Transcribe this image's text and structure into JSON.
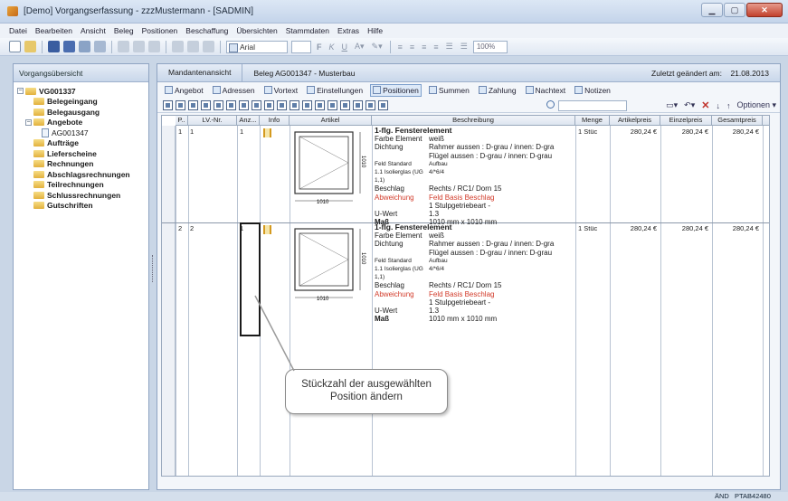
{
  "window": {
    "title": "[Demo] Vorgangserfassung - zzzMustermann - [SADMIN]"
  },
  "menu": [
    "Datei",
    "Bearbeiten",
    "Ansicht",
    "Beleg",
    "Positionen",
    "Beschaffung",
    "Übersichten",
    "Stammdaten",
    "Extras",
    "Hilfe"
  ],
  "toolbar": {
    "font": "Arial",
    "zoom": "100%"
  },
  "sidebar": {
    "header": "Vorgangsübersicht",
    "tree": [
      {
        "label": "VG001337",
        "level": 0,
        "bold": true,
        "expander": "−",
        "icon": "folder"
      },
      {
        "label": "Belegeingang",
        "level": 1,
        "bold": true,
        "icon": "folder"
      },
      {
        "label": "Belegausgang",
        "level": 1,
        "bold": true,
        "icon": "folder"
      },
      {
        "label": "Angebote",
        "level": 1,
        "bold": true,
        "expander": "−",
        "icon": "folder"
      },
      {
        "label": "AG001347",
        "level": 2,
        "bold": false,
        "icon": "doc"
      },
      {
        "label": "Aufträge",
        "level": 1,
        "bold": true,
        "icon": "folder"
      },
      {
        "label": "Lieferscheine",
        "level": 1,
        "bold": true,
        "icon": "folder"
      },
      {
        "label": "Rechnungen",
        "level": 1,
        "bold": true,
        "icon": "folder"
      },
      {
        "label": "Abschlagsrechnungen",
        "level": 1,
        "bold": true,
        "icon": "folder"
      },
      {
        "label": "Teilrechnungen",
        "level": 1,
        "bold": true,
        "icon": "folder"
      },
      {
        "label": "Schlussrechnungen",
        "level": 1,
        "bold": true,
        "icon": "folder"
      },
      {
        "label": "Gutschriften",
        "level": 1,
        "bold": true,
        "icon": "folder"
      }
    ]
  },
  "header": {
    "tab": "Mandantenansicht",
    "beleg": "Beleg AG001347 - Musterbau",
    "changed_label": "Zuletzt geändert am:",
    "changed_date": "21.08.2013"
  },
  "actions": [
    {
      "label": "Angebot",
      "selected": false
    },
    {
      "label": "Adressen",
      "selected": false
    },
    {
      "label": "Vortext",
      "selected": false
    },
    {
      "label": "Einstellungen",
      "selected": false
    },
    {
      "label": "Positionen",
      "selected": true
    },
    {
      "label": "Summen",
      "selected": false
    },
    {
      "label": "Zahlung",
      "selected": false
    },
    {
      "label": "Nachtext",
      "selected": false
    },
    {
      "label": "Notizen",
      "selected": false
    }
  ],
  "options_label": "Optionen",
  "grid": {
    "columns": [
      "P..",
      "LV.-Nr.",
      "Anz...",
      "Info",
      "Artikel",
      "Beschreibung",
      "Menge",
      "Artikelpreis",
      "Einzelpreis",
      "Gesamtpreis"
    ],
    "rows": [
      {
        "p": "1",
        "lv": "1",
        "anz": "1",
        "dim_w": "1010",
        "dim_h": "1010",
        "menge": "1 Stüc",
        "artikelpreis": "280,24 €",
        "einzelpreis": "280,24 €",
        "gesamtpreis": "280,24 €",
        "title": "1-flg. Fensterelement",
        "farbe_k": "Farbe Element",
        "farbe_v": "weiß",
        "dicht_k": "Dichtung",
        "dicht_v1": "Rahmer aussen : D-grau / innen: D-gra",
        "dicht_v2": "Flügel aussen : D-grau / innen: D-grau",
        "feld_k": "Feld  Standard",
        "feld_v": "Aufbau",
        "glas_k": "1.1   Isolierglas (UG 1,1)",
        "glas_v": "4/*6/4",
        "beschlag_k": "Beschlag",
        "beschlag_v": "Rechts / RC1/ Dorn 15",
        "abw_k": "Abweichung",
        "abw_v": "Feld   Basis Beschlag",
        "stulp_v": "1   Stulpgetriebeart   -",
        "uwert_k": "U-Wert",
        "uwert_v": "1.3",
        "mass_k": "Maß",
        "mass_v": "1010 mm x  1010 mm"
      },
      {
        "p": "2",
        "lv": "2",
        "anz": "1",
        "dim_w": "1010",
        "dim_h": "1010",
        "menge": "1 Stüc",
        "artikelpreis": "280,24 €",
        "einzelpreis": "280,24 €",
        "gesamtpreis": "280,24 €",
        "title": "1-flg. Fensterelement",
        "farbe_k": "Farbe Element",
        "farbe_v": "weiß",
        "dicht_k": "Dichtung",
        "dicht_v1": "Rahmer aussen : D-grau / innen: D-gra",
        "dicht_v2": "Flügel aussen : D-grau / innen: D-grau",
        "feld_k": "Feld  Standard",
        "feld_v": "Aufbau",
        "glas_k": "1.1   Isolierglas (UG 1,1)",
        "glas_v": "4/*6/4",
        "beschlag_k": "Beschlag",
        "beschlag_v": "Rechts / RC1/ Dorn 15",
        "abw_k": "Abweichung",
        "abw_v": "Feld   Basis Beschlag",
        "stulp_v": "1   Stulpgetriebeart   -",
        "uwert_k": "U-Wert",
        "uwert_v": "1.3",
        "mass_k": "Maß",
        "mass_v": "1010 mm x  1010 mm"
      }
    ]
  },
  "callout": {
    "line1": "Stückzahl der ausgewählten",
    "line2": "Position ändern"
  },
  "status": {
    "mode": "ÄND",
    "user": "PTAB42480"
  }
}
